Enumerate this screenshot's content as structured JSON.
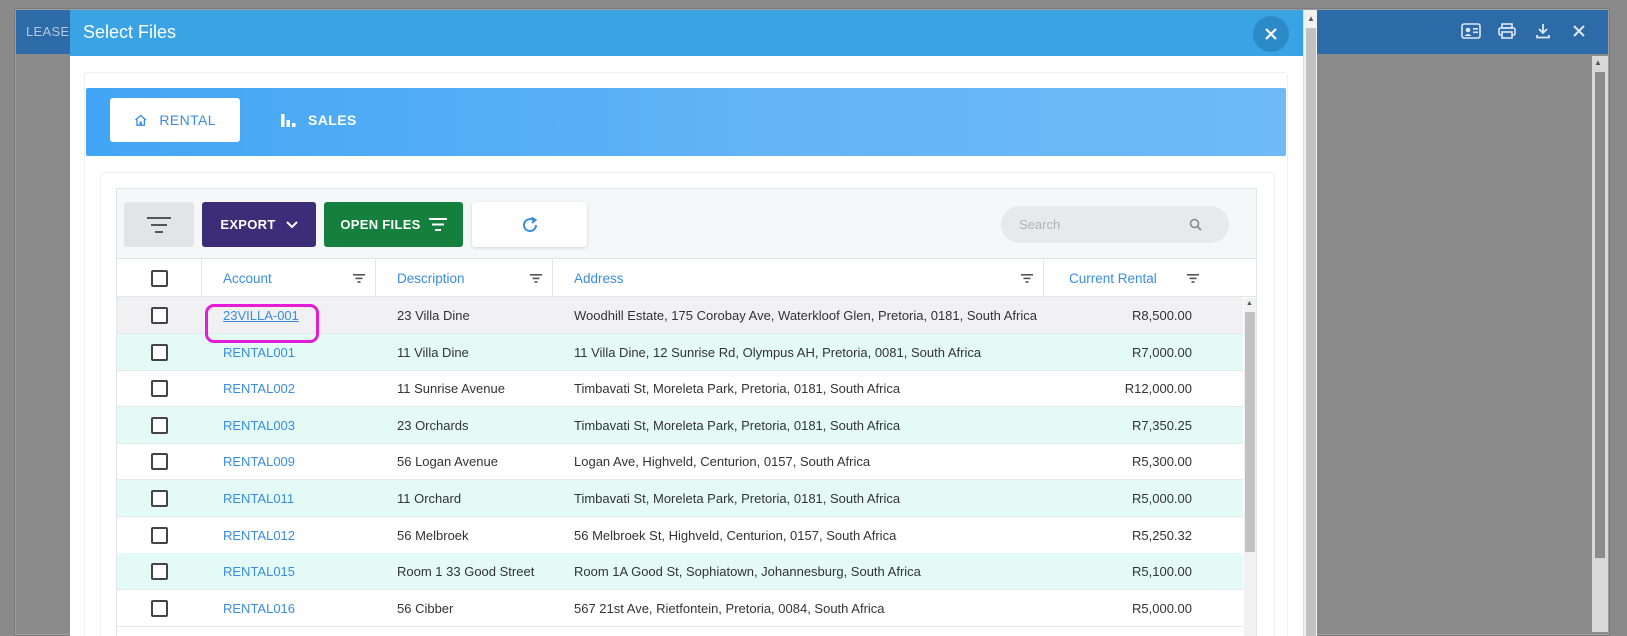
{
  "background_window": {
    "title": "LEASE",
    "icons": [
      "contact-card-icon",
      "print-icon",
      "download-icon",
      "close-icon"
    ]
  },
  "modal": {
    "title": "Select Files",
    "close_icon": "close-icon"
  },
  "tabs": [
    {
      "label": "RENTAL",
      "icon": "home-icon",
      "active": true
    },
    {
      "label": "SALES",
      "icon": "bar-chart-icon",
      "active": false
    }
  ],
  "toolbar": {
    "filter_icon": "filter-lines-icon",
    "export_label": "EXPORT",
    "open_files_label": "OPEN FILES",
    "refresh_icon": "refresh-icon",
    "search_placeholder": "Search"
  },
  "columns": {
    "account": "Account",
    "description": "Description",
    "address": "Address",
    "current_rental": "Current Rental"
  },
  "rows": [
    {
      "account": "23VILLA-001",
      "description": "23 Villa Dine",
      "address": "Woodhill Estate, 175 Corobay Ave, Waterkloof Glen, Pretoria, 0181, South Africa",
      "rental": "R8,500.00"
    },
    {
      "account": "RENTAL001",
      "description": "11 Villa Dine",
      "address": "11 Villa Dine, 12 Sunrise Rd, Olympus AH, Pretoria, 0081, South Africa",
      "rental": "R7,000.00"
    },
    {
      "account": "RENTAL002",
      "description": "11 Sunrise Avenue",
      "address": "Timbavati St, Moreleta Park, Pretoria, 0181, South Africa",
      "rental": "R12,000.00"
    },
    {
      "account": "RENTAL003",
      "description": "23 Orchards",
      "address": "Timbavati St, Moreleta Park, Pretoria, 0181, South Africa",
      "rental": "R7,350.25"
    },
    {
      "account": "RENTAL009",
      "description": "56 Logan Avenue",
      "address": "Logan Ave, Highveld, Centurion, 0157, South Africa",
      "rental": "R5,300.00"
    },
    {
      "account": "RENTAL011",
      "description": "11 Orchard",
      "address": "Timbavati St, Moreleta Park, Pretoria, 0181, South Africa",
      "rental": "R5,000.00"
    },
    {
      "account": "RENTAL012",
      "description": "56 Melbroek",
      "address": "56 Melbroek St, Highveld, Centurion, 0157, South Africa",
      "rental": "R5,250.32"
    },
    {
      "account": "RENTAL015",
      "description": "Room 1 33 Good Street",
      "address": "Room 1A Good St, Sophiatown, Johannesburg, South Africa",
      "rental": "R5,100.00"
    },
    {
      "account": "RENTAL016",
      "description": "56 Cibber",
      "address": "567 21st Ave, Rietfontein, Pretoria, 0084, South Africa",
      "rental": "R5,000.00"
    }
  ],
  "colors": {
    "modal_header": "#3aa3e3",
    "accent_blue": "#3a8dde",
    "export_button": "#3b2d78",
    "open_files_button": "#15803d",
    "row_alt": "#e3faf6",
    "highlight": "#e41bd7"
  }
}
